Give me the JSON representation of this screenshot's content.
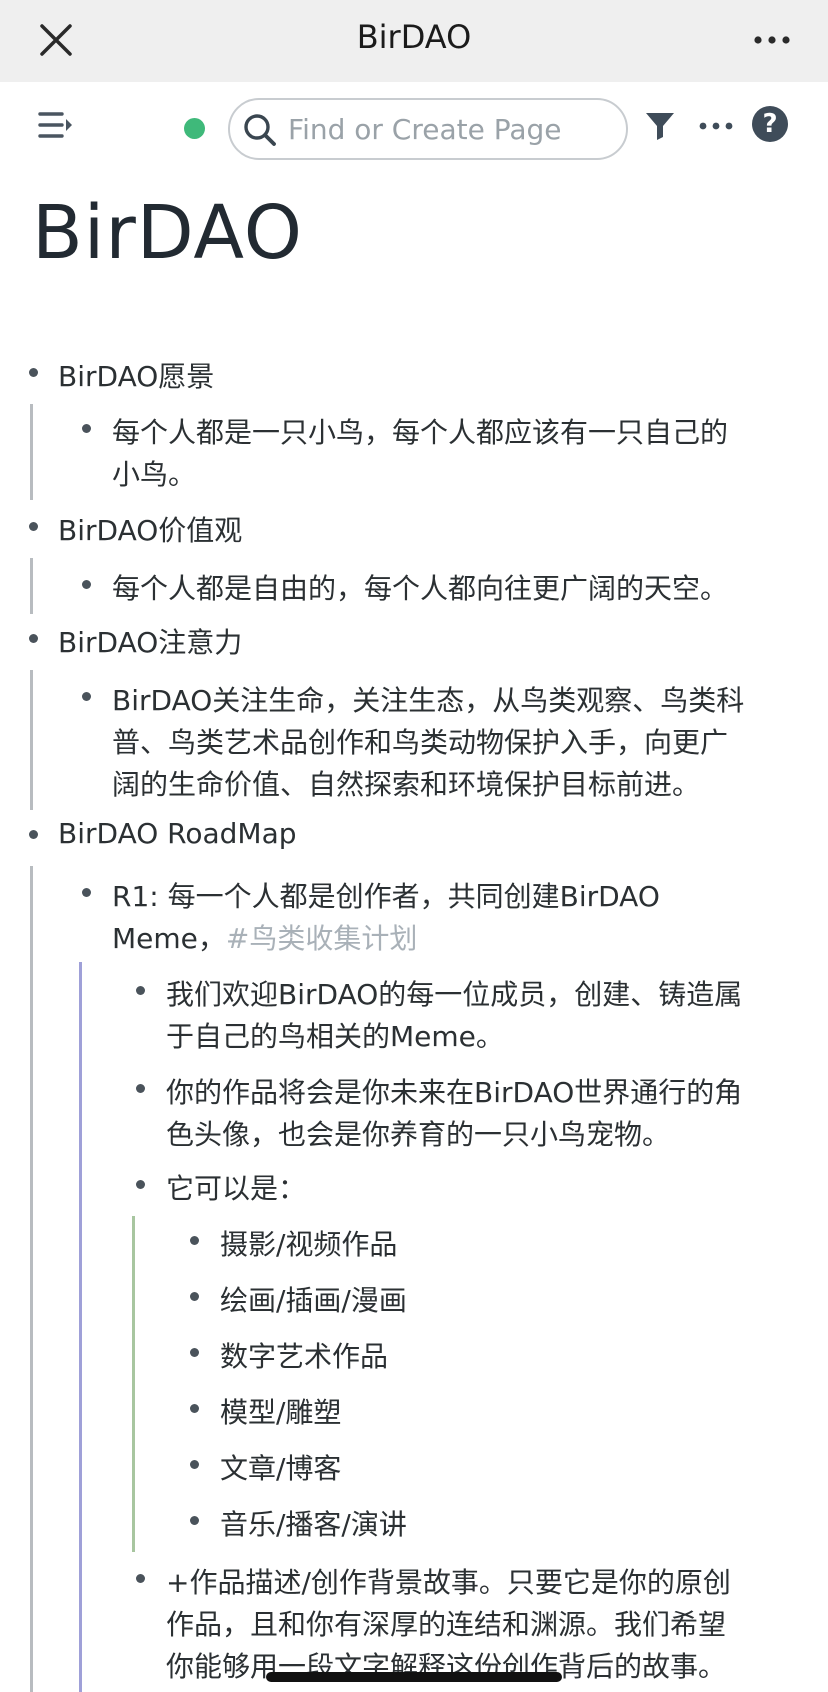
{
  "window": {
    "title": "BirDAO"
  },
  "toolbar": {
    "search_placeholder": "Find or Create Page"
  },
  "page": {
    "title": "BirDAO"
  },
  "outline": [
    {
      "id": "vision",
      "text": "BirDAO愿景"
    },
    {
      "id": "vision_1a",
      "text": "每个人都是一只小鸟，每个人都应该有一只自己的"
    },
    {
      "id": "vision_1b",
      "text": "小鸟。"
    },
    {
      "id": "values",
      "text": "BirDAO价值观"
    },
    {
      "id": "values_1",
      "text": "每个人都是自由的，每个人都向往更广阔的天空。"
    },
    {
      "id": "attention",
      "text": "BirDAO注意力"
    },
    {
      "id": "attention_1a",
      "text": "BirDAO关注生命，关注生态，从鸟类观察、鸟类科"
    },
    {
      "id": "attention_1b",
      "text": "普、鸟类艺术品创作和鸟类动物保护入手，向更广"
    },
    {
      "id": "attention_1c",
      "text": "阔的生命价值、自然探索和环境保护目标前进。"
    },
    {
      "id": "roadmap",
      "text": "BirDAO RoadMap"
    },
    {
      "id": "r1a",
      "text": "R1: 每一个人都是创作者，共同创建BirDAO"
    },
    {
      "id": "r1b",
      "text": "Meme，"
    },
    {
      "id": "r1tag",
      "text": "#鸟类收集计划"
    },
    {
      "id": "r1_1a",
      "text": "我们欢迎BirDAO的每一位成员，创建、铸造属"
    },
    {
      "id": "r1_1b",
      "text": "于自己的鸟相关的Meme。"
    },
    {
      "id": "r1_2a",
      "text": "你的作品将会是你未来在BirDAO世界通行的角"
    },
    {
      "id": "r1_2b",
      "text": "色头像，也会是你养育的一只小鸟宠物。"
    },
    {
      "id": "r1_3",
      "text": "它可以是："
    },
    {
      "id": "r1_3_1",
      "text": "摄影/视频作品"
    },
    {
      "id": "r1_3_2",
      "text": "绘画/插画/漫画"
    },
    {
      "id": "r1_3_3",
      "text": "数字艺术作品"
    },
    {
      "id": "r1_3_4",
      "text": "模型/雕塑"
    },
    {
      "id": "r1_3_5",
      "text": "文章/博客"
    },
    {
      "id": "r1_3_6",
      "text": "音乐/播客/演讲"
    },
    {
      "id": "r1_4a",
      "text": "+作品描述/创作背景故事。只要它是你的原创"
    },
    {
      "id": "r1_4b",
      "text": "作品，且和你有深厚的连结和渊源。我们希望"
    },
    {
      "id": "r1_4c",
      "text": "你能够用一段文字解释这份创作背后的故事。"
    }
  ],
  "colors": {
    "status_online": "#3fb97a",
    "tag_text": "#a9b1b8",
    "bar_level1": "#b8bcc0",
    "bar_level2": "#9fa0d8",
    "bar_level3": "#a8c6a0"
  }
}
